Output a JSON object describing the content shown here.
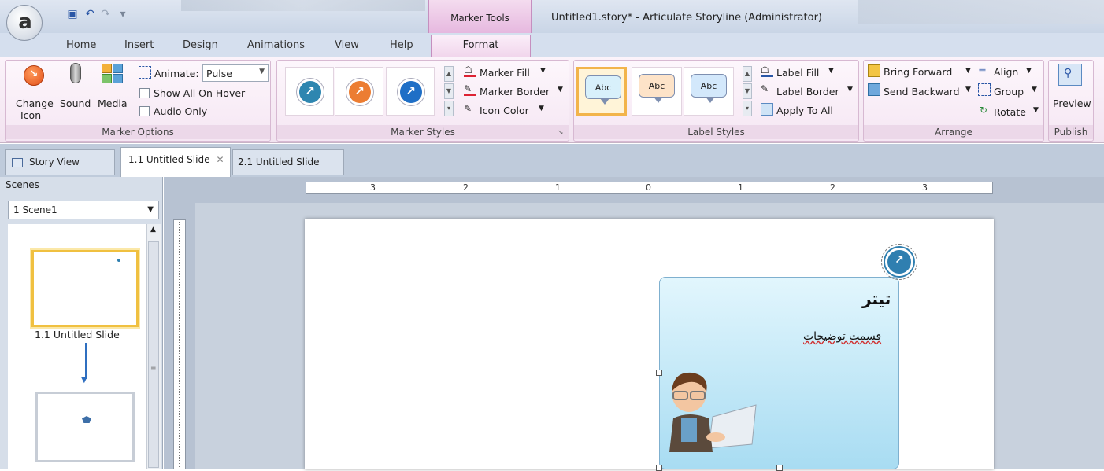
{
  "titlebar": {
    "window_title": "Untitled1.story* -  Articulate Storyline (Administrator)",
    "context_tab_group": "Marker Tools",
    "app_logo": "a"
  },
  "tabs": [
    "Home",
    "Insert",
    "Design",
    "Animations",
    "View",
    "Help",
    "Format"
  ],
  "ribbon": {
    "marker_options": {
      "label": "Marker Options",
      "change_icon": "Change",
      "change_icon2": "Icon",
      "sound": "Sound",
      "media": "Media",
      "animate_label": "Animate:",
      "animate_value": "Pulse",
      "show_all_on_hover": "Show All On Hover",
      "audio_only": "Audio Only"
    },
    "marker_styles": {
      "label": "Marker Styles",
      "marker_fill": "Marker Fill",
      "marker_border": "Marker Border",
      "icon_color": "Icon Color",
      "colors": [
        "#2e86b0",
        "#ec7d32",
        "#1f6fc6"
      ]
    },
    "label_styles": {
      "label": "Label Styles",
      "items": [
        "Abc",
        "Abc",
        "Abc"
      ],
      "colors": [
        "#d8f0fb",
        "#fde3c8",
        "#d3e8fb"
      ],
      "label_fill": "Label Fill",
      "label_border": "Label Border",
      "apply_to_all": "Apply To All"
    },
    "arrange": {
      "label": "Arrange",
      "bring_forward": "Bring Forward",
      "send_backward": "Send Backward",
      "align": "Align",
      "group": "Group",
      "rotate": "Rotate"
    },
    "publish": {
      "label": "Publish",
      "preview": "Preview"
    }
  },
  "doc_tabs": {
    "story_view": "Story View",
    "slide1": "1.1 Untitled Slide",
    "slide2": "2.1 Untitled Slide"
  },
  "scenes": {
    "header": "Scenes",
    "selected": "1 Scene1",
    "thumb1_caption": "1.1 Untitled Slide"
  },
  "ruler": {
    "marks": [
      "3",
      "2",
      "1",
      "0",
      "1",
      "2",
      "3"
    ]
  },
  "slide": {
    "callout_title": "تیتر",
    "callout_body": "قسمت توضیحات"
  }
}
